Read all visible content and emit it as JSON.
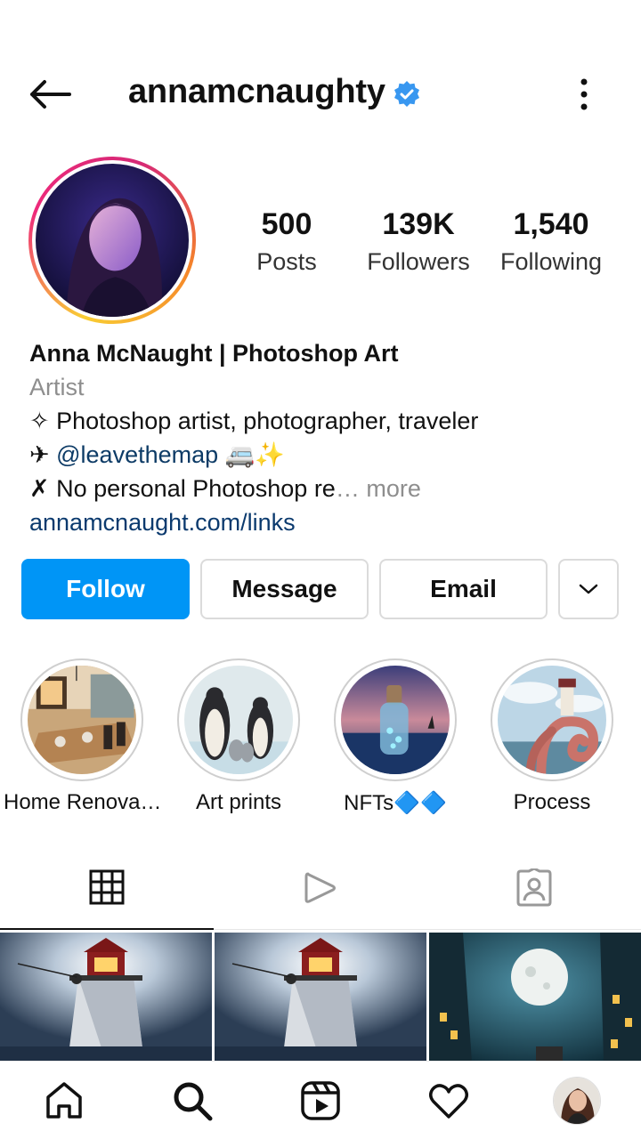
{
  "header": {
    "username": "annamcnaughty",
    "verified": true,
    "icons": {
      "back": "arrow-left-icon",
      "verified": "verified-badge-icon",
      "more": "kebab-menu-icon"
    }
  },
  "profile": {
    "stats": {
      "posts": {
        "value": "500",
        "label": "Posts"
      },
      "followers": {
        "value": "139K",
        "label": "Followers"
      },
      "following": {
        "value": "1,540",
        "label": "Following"
      }
    },
    "name": "Anna McNaught | Photoshop Art",
    "category": "Artist",
    "bio": {
      "line1": "✧ Photoshop artist, photographer, traveler",
      "line2_prefix": "✈ ",
      "line2_mention": "@leavethemap",
      "line2_suffix": " 🚐✨",
      "line3": "✗ No personal Photoshop re",
      "line3_more": "… more",
      "link": "annamcnaught.com/links"
    }
  },
  "actions": {
    "follow": "Follow",
    "message": "Message",
    "email": "Email",
    "dropdown_icon": "chevron-down-icon"
  },
  "highlights": [
    {
      "title": "Home Renova…"
    },
    {
      "title": "Art prints"
    },
    {
      "title": "NFTs🔷🔷"
    },
    {
      "title": "Process"
    }
  ],
  "tabs": [
    {
      "icon": "grid-icon",
      "active": true
    },
    {
      "icon": "reels-play-icon",
      "active": false
    },
    {
      "icon": "tagged-user-icon",
      "active": false
    }
  ],
  "bottom_nav": [
    {
      "icon": "home-icon"
    },
    {
      "icon": "search-icon"
    },
    {
      "icon": "reels-icon"
    },
    {
      "icon": "heart-icon"
    },
    {
      "icon": "profile-avatar"
    }
  ],
  "colors": {
    "follow_button": "#0095f6",
    "verified_badge": "#3897f0",
    "link": "#0b3a6e"
  }
}
